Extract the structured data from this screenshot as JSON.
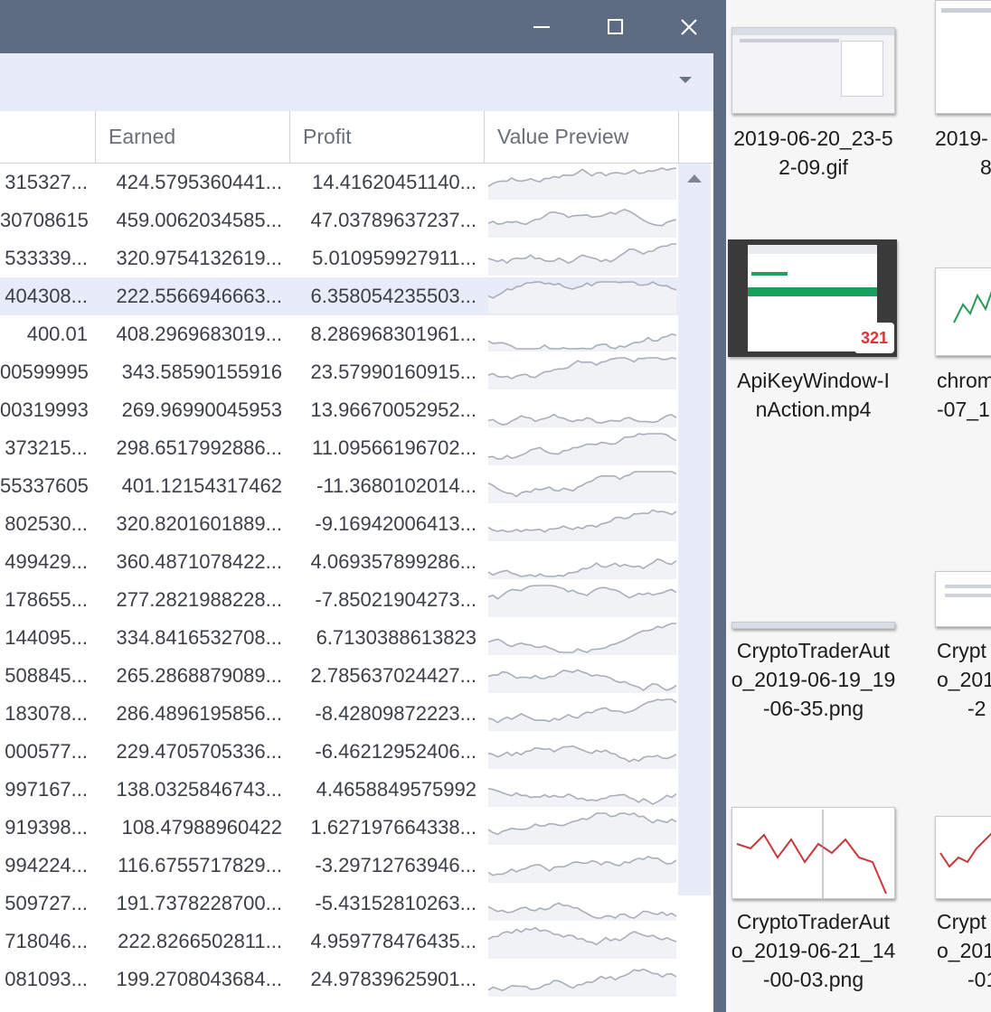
{
  "window": {
    "controls": [
      "minimize",
      "maximize",
      "close"
    ],
    "toolbar_dropdown_icon": "chevron-down-icon"
  },
  "grid": {
    "columns": [
      "Earned",
      "Profit",
      "Value Preview"
    ],
    "rows": [
      {
        "prev": "315327...",
        "earned": "424.5795360441...",
        "profit": "14.41620451140...",
        "selected": false
      },
      {
        "prev": "30708615",
        "earned": "459.0062034585...",
        "profit": "47.03789637237...",
        "selected": false
      },
      {
        "prev": "533339...",
        "earned": "320.9754132619...",
        "profit": "5.010959927911...",
        "selected": false
      },
      {
        "prev": "404308...",
        "earned": "222.5566946663...",
        "profit": "6.358054235503...",
        "selected": true
      },
      {
        "prev": "400.01",
        "earned": "408.2969683019...",
        "profit": "8.286968301961...",
        "selected": false
      },
      {
        "prev": "00599995",
        "earned": "343.58590155916",
        "profit": "23.57990160915...",
        "selected": false
      },
      {
        "prev": "00319993",
        "earned": "269.96990045953",
        "profit": "13.96670052952...",
        "selected": false
      },
      {
        "prev": "373215...",
        "earned": "298.6517992886...",
        "profit": "11.09566196702...",
        "selected": false
      },
      {
        "prev": "55337605",
        "earned": "401.12154317462",
        "profit": "-11.3680102014...",
        "selected": false
      },
      {
        "prev": "802530...",
        "earned": "320.8201601889...",
        "profit": "-9.16942006413...",
        "selected": false
      },
      {
        "prev": "499429...",
        "earned": "360.4871078422...",
        "profit": "4.069357899286...",
        "selected": false
      },
      {
        "prev": "178655...",
        "earned": "277.2821988228...",
        "profit": "-7.85021904273...",
        "selected": false
      },
      {
        "prev": "144095...",
        "earned": "334.8416532708...",
        "profit": "6.7130388613823",
        "selected": false
      },
      {
        "prev": "508845...",
        "earned": "265.2868879089...",
        "profit": "2.785637024427...",
        "selected": false
      },
      {
        "prev": "183078...",
        "earned": "286.4896195856...",
        "profit": "-8.42809872223...",
        "selected": false
      },
      {
        "prev": "000577...",
        "earned": "229.4705705336...",
        "profit": "-6.46212952406...",
        "selected": false
      },
      {
        "prev": "997167...",
        "earned": "138.0325846743...",
        "profit": "4.4658849575992",
        "selected": false
      },
      {
        "prev": "919398...",
        "earned": "108.47988960422",
        "profit": "1.627197664338...",
        "selected": false
      },
      {
        "prev": "994224...",
        "earned": "116.6755717829...",
        "profit": "-3.29712763946...",
        "selected": false
      },
      {
        "prev": "509727...",
        "earned": "191.7378228700...",
        "profit": "-5.43152810263...",
        "selected": false
      },
      {
        "prev": "718046...",
        "earned": "222.8266502811...",
        "profit": "4.959778476435...",
        "selected": false
      },
      {
        "prev": "081093...",
        "earned": "199.2708043684...",
        "profit": "24.97839625901...",
        "selected": false
      }
    ]
  },
  "desktop": {
    "files": [
      {
        "label_lines": [
          "2019-06-20_23-5",
          "2-09.gif"
        ]
      },
      {
        "label_lines": [
          "2019-",
          "8"
        ]
      },
      {
        "label_lines": [
          "ApiKeyWindow-I",
          "nAction.mp4"
        ]
      },
      {
        "label_lines": [
          "chrom",
          "-07_1"
        ]
      },
      {
        "label_lines": [
          "CryptoTraderAut",
          "o_2019-06-19_19",
          "-06-35.png"
        ]
      },
      {
        "label_lines": [
          "Crypt",
          "o_201",
          "-2"
        ]
      },
      {
        "label_lines": [
          "CryptoTraderAut",
          "o_2019-06-21_14",
          "-00-03.png"
        ]
      },
      {
        "label_lines": [
          "Crypt",
          "o_201",
          "-01"
        ]
      }
    ],
    "video_badge": "321"
  },
  "colors": {
    "titlebar": "#5d6b83",
    "toolbar": "#e7ecf8",
    "selected_row": "#e7ecf8",
    "sparkline_fill": "#f0f2f5",
    "sparkline_line": "#a9afba",
    "video_green": "#16a05c"
  }
}
